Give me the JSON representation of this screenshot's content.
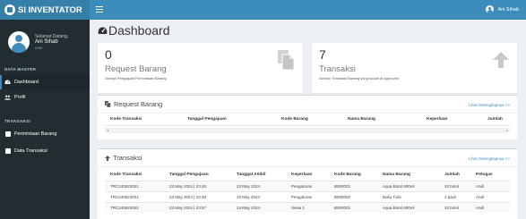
{
  "brand": {
    "name": "SI INVENTATOR"
  },
  "user": {
    "greeting": "Selamat Datang,",
    "name": "Ani Sihab",
    "status": "user"
  },
  "topbar": {
    "user_name": "Ani Sihab"
  },
  "menu": {
    "master_header": "DATA MASTER",
    "dashboard": "Dashboard",
    "profil": "Profil",
    "transaksi_header": "TRANSAKSI",
    "permintaan": "Permintaan Barang",
    "data_transaksi": "Data Transaksi"
  },
  "page": {
    "title": "Dashboard"
  },
  "boxes": {
    "request": {
      "count": "0",
      "label": "Request Barang",
      "sub": "Jumlah Pengajuan Permintaan Barang"
    },
    "transaksi": {
      "count": "7",
      "label": "Transaksi",
      "sub": "Jumlah Transaksi Barang yang sudah di Approved"
    }
  },
  "request_panel": {
    "title": "Request Barang",
    "link": "Lihat Selengkapnya >>",
    "columns": [
      "Kode Transaksi",
      "Tanggal Pengajuan",
      "Kode Barang",
      "Nama Barang",
      "Keperluan",
      "Jumlah"
    ]
  },
  "transaksi_panel": {
    "title": "Transaksi",
    "link": "Lihat Selengkapnya >>",
    "columns": [
      "Kode Transaksi",
      "Tanggal Pengajuan",
      "Tanggal Ambil",
      "Keperluan",
      "Kode Barang",
      "Nama Barang",
      "Jumlah",
      "Petugas"
    ],
    "rows": [
      [
        "TRC240523001",
        "23 May 2024 | 23:48",
        "23 May 2024",
        "Pengaturan",
        "B000001",
        "Aqua Botol 600ml",
        "20 botol",
        "Andi"
      ],
      [
        "TRC240523001",
        "23 May 2024 | 23:48",
        "23 May 2024",
        "Pengaturan",
        "B000002",
        "Buku Tulis",
        "2 pack",
        "Andi"
      ],
      [
        "TRC240523002",
        "23 May 2024 | 23:57",
        "24 May 2024",
        "Sekai 1",
        "B000001",
        "Aqua Botol 600ml",
        "20 botol",
        "Andi"
      ]
    ]
  },
  "colors": {
    "brand": "#367fa9",
    "topbar": "#3c8dbc",
    "sidebar": "#222d32",
    "content_bg": "#ecf0f5"
  }
}
